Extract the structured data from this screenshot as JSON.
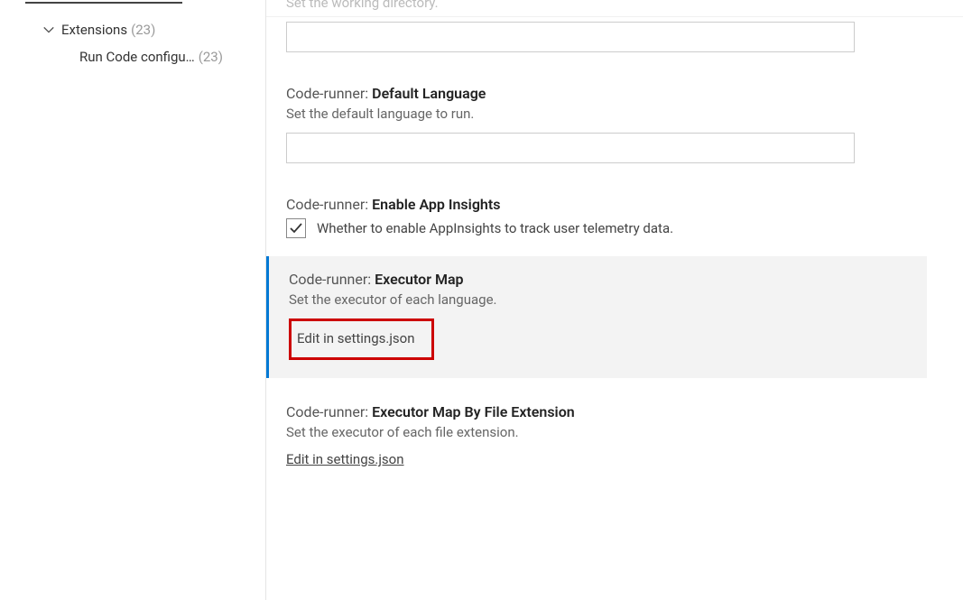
{
  "sidebar": {
    "extensions": {
      "label": "Extensions",
      "count": "(23)"
    },
    "runCode": {
      "label": "Run Code configu…",
      "count": "(23)"
    }
  },
  "settings": {
    "cwd": {
      "desc_cut": "Set the working directory.",
      "value": ""
    },
    "defaultLang": {
      "prefix": "Code-runner: ",
      "name": "Default Language",
      "desc": "Set the default language to run.",
      "value": ""
    },
    "appInsights": {
      "prefix": "Code-runner: ",
      "name": "Enable App Insights",
      "checkbox_label": "Whether to enable AppInsights to track user telemetry data.",
      "checked": true
    },
    "executorMap": {
      "prefix": "Code-runner: ",
      "name": "Executor Map",
      "desc": "Set the executor of each language.",
      "edit_link": "Edit in settings.json"
    },
    "executorMapByExt": {
      "prefix": "Code-runner: ",
      "name": "Executor Map By File Extension",
      "desc": "Set the executor of each file extension.",
      "edit_link": "Edit in settings.json"
    }
  }
}
